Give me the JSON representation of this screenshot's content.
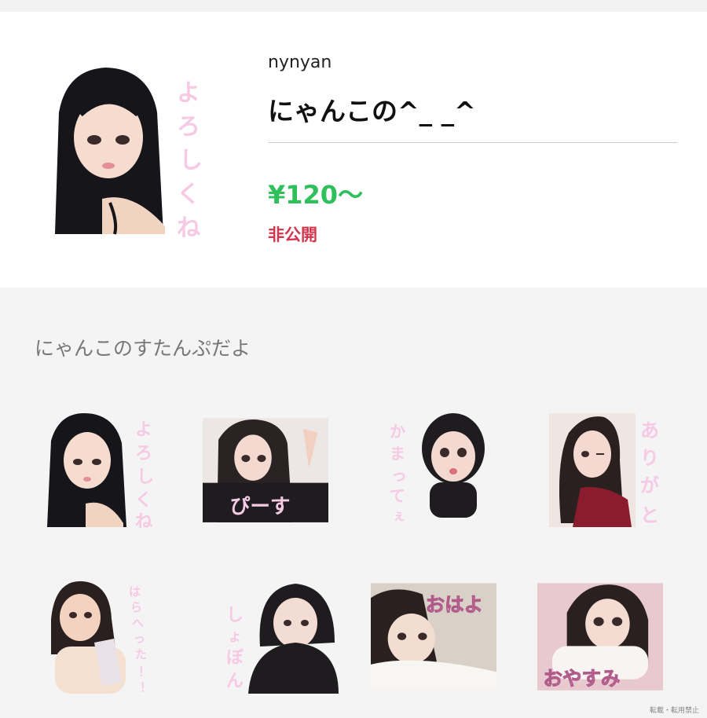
{
  "header": {
    "author": "nynyan",
    "title": "にゃんこの^_ _^",
    "price": "¥120～",
    "status": "非公開"
  },
  "description": "にゃんこのすたんぷだよ",
  "stickers": [
    {
      "caption": "よろしくね"
    },
    {
      "caption": "ぴーす"
    },
    {
      "caption": "かまってぇ"
    },
    {
      "caption": "ありがと"
    },
    {
      "caption": "はらへった！！"
    },
    {
      "caption": "しょぼん"
    },
    {
      "caption": "おはよ"
    },
    {
      "caption": "おやすみ"
    }
  ],
  "main_sticker": {
    "caption": "よろしくね"
  },
  "footer": "転載・転用禁止",
  "colors": {
    "price": "#2fc05b",
    "status": "#d1354d",
    "caption_pink": "#f6c9e4"
  }
}
